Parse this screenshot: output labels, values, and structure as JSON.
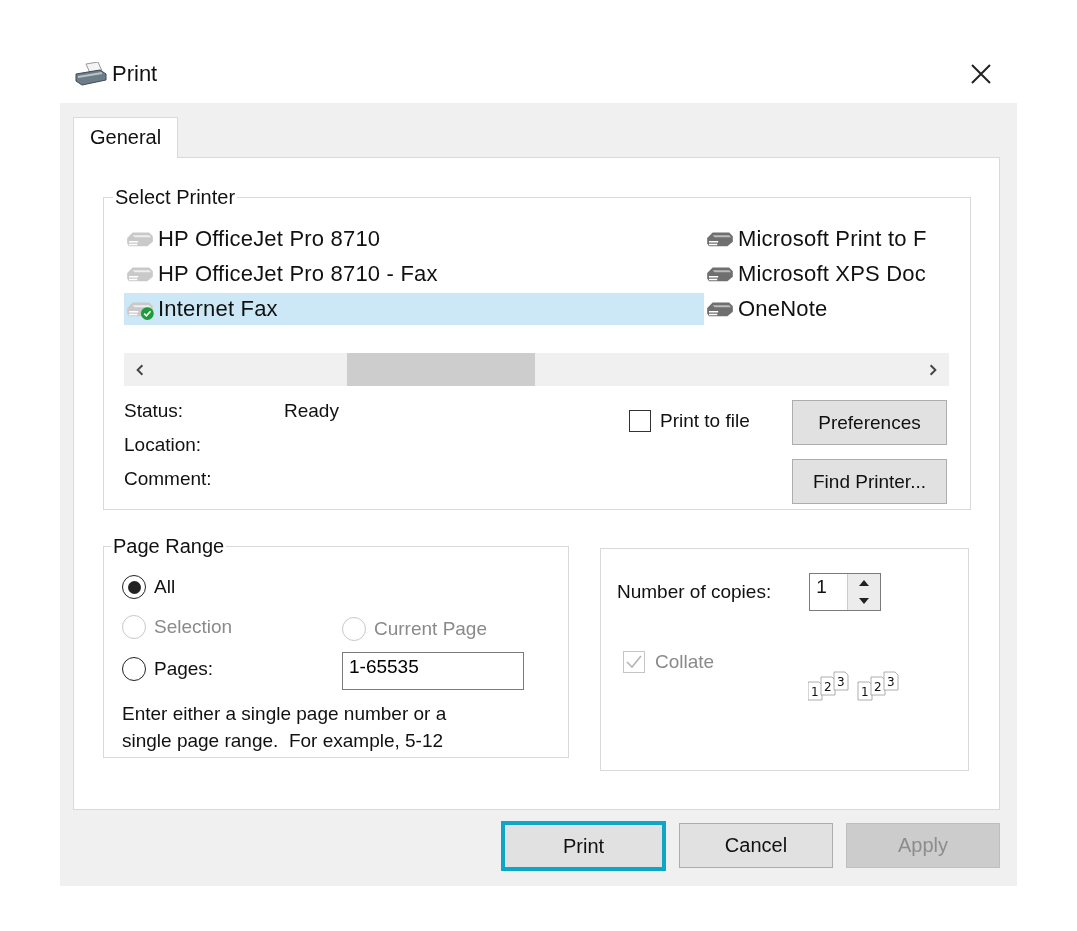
{
  "window": {
    "title": "Print"
  },
  "tabs": [
    {
      "label": "General",
      "selected": true
    }
  ],
  "select_printer": {
    "legend": "Select Printer",
    "columns": [
      [
        {
          "name": "HP OfficeJet Pro 8710",
          "selected": false,
          "default": false
        },
        {
          "name": "HP OfficeJet Pro 8710 - Fax",
          "selected": false,
          "default": false
        },
        {
          "name": "Internet Fax",
          "selected": true,
          "default": true
        }
      ],
      [
        {
          "name": "Microsoft Print to F",
          "selected": false,
          "default": false
        },
        {
          "name": "Microsoft XPS Doc",
          "selected": false,
          "default": false
        },
        {
          "name": "OneNote",
          "selected": false,
          "default": false
        }
      ]
    ],
    "status": {
      "label": "Status:",
      "value": "Ready"
    },
    "location": {
      "label": "Location:"
    },
    "comment": {
      "label": "Comment:"
    },
    "print_to_file": {
      "label": "Print to file",
      "checked": false
    },
    "buttons": [
      {
        "label": "Preferences"
      },
      {
        "label": "Find Printer..."
      }
    ]
  },
  "page_range": {
    "legend": "Page Range",
    "options": [
      {
        "label": "All",
        "selected": true,
        "disabled": false
      },
      {
        "label": "Selection",
        "selected": false,
        "disabled": true
      },
      {
        "label": "Current Page",
        "selected": false,
        "disabled": true
      },
      {
        "label": "Pages:",
        "selected": false,
        "disabled": false
      }
    ],
    "pages_value": "1-65535",
    "hint": "Enter either a single page number or a single page range.  For example, 5-12"
  },
  "copies": {
    "label": "Number of copies:",
    "value": "1",
    "collate": {
      "label": "Collate",
      "checked": true,
      "disabled": true
    },
    "collate_sets": [
      [
        "1",
        "2",
        "3"
      ],
      [
        "1",
        "2",
        "3"
      ]
    ]
  },
  "buttons": [
    {
      "label": "Print",
      "focused": true,
      "disabled": false
    },
    {
      "label": "Cancel",
      "focused": false,
      "disabled": false
    },
    {
      "label": "Apply",
      "focused": false,
      "disabled": true
    }
  ]
}
